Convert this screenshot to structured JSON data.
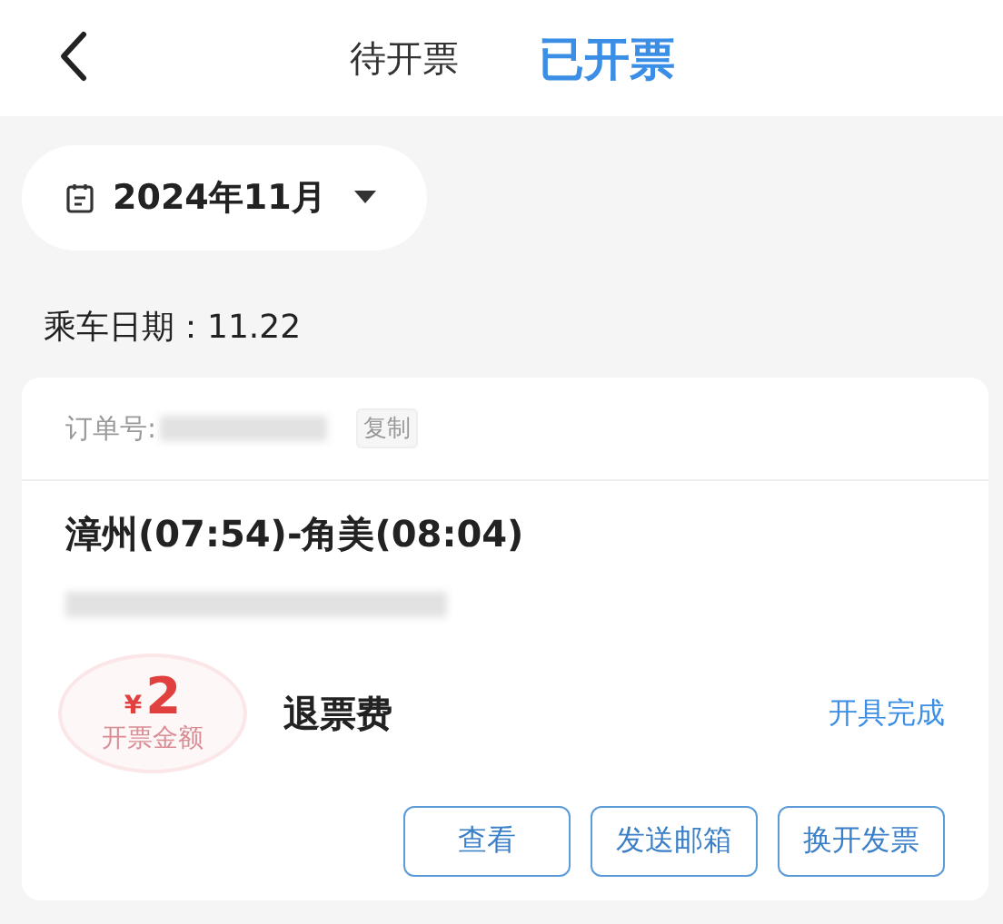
{
  "header": {
    "tabs": [
      {
        "label": "待开票",
        "selected": false
      },
      {
        "label": "已开票",
        "selected": true
      }
    ]
  },
  "month_picker": {
    "label": "2024年11月"
  },
  "ride_date": "乘车日期：11.22",
  "invoice": {
    "order_label": "订单号:",
    "copy": "复制",
    "route": "漳州(07:54)-角美(08:04)",
    "currency": "¥",
    "amount": "2",
    "stamp_label": "开票金额",
    "type": "退票费",
    "status": "开具完成",
    "actions": [
      {
        "label": "查看"
      },
      {
        "label": "发送邮箱"
      },
      {
        "label": "换开发票"
      }
    ]
  }
}
